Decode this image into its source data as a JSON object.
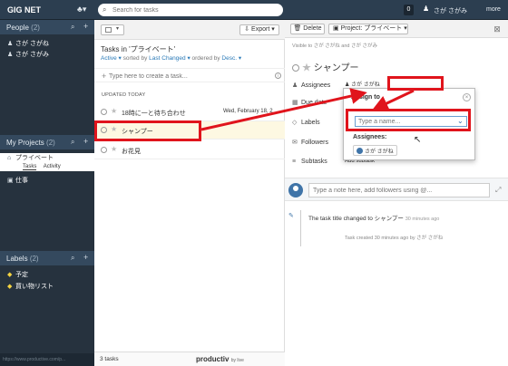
{
  "topbar": {
    "brand": "GIG NET",
    "search_placeholder": "Search for tasks",
    "notifications": "0",
    "user_name": "さが さがみ",
    "more": "more"
  },
  "sidebar": {
    "people": {
      "title": "People",
      "count": "(2)",
      "items": [
        {
          "label": "さが さがね"
        },
        {
          "label": "さが さがみ"
        }
      ]
    },
    "projects": {
      "title": "My Projects",
      "count": "(2)",
      "items": [
        {
          "label": "プライベート",
          "tabs": [
            "Tasks",
            "Activity"
          ]
        },
        {
          "label": "仕事"
        }
      ]
    },
    "labels": {
      "title": "Labels",
      "count": "(2)",
      "items": [
        {
          "label": "予定"
        },
        {
          "label": "買い物リスト"
        }
      ]
    },
    "status": "https://www.productive.com/p..."
  },
  "task_list": {
    "export_label": "Export",
    "title": "Tasks in 'プライベート'",
    "filter": {
      "state": "Active",
      "sorted_by_text": "sorted by",
      "sort": "Last Changed",
      "ordered_by_text": "ordered by",
      "order": "Desc."
    },
    "new_task_placeholder": "Type here to create a task...",
    "group_header": "UPDATED TODAY",
    "tasks": [
      {
        "name": "18時に一と待ち合わせ",
        "date": "Wed, February 18, 2"
      },
      {
        "name": "シャンプー",
        "date": ""
      },
      {
        "name": "お花見",
        "date": ""
      }
    ],
    "footer_count": "3 tasks",
    "footer_brand": "productiv",
    "footer_by": "by live"
  },
  "detail": {
    "delete_label": "Delete",
    "project_label": "Project: プライベート",
    "visible_to": "Visible to さが さがね and さが さがみ",
    "task_title": "シャンプー",
    "fields": {
      "assignees": "Assignees",
      "due": "Due date",
      "labels": "Labels",
      "followers": "Followers",
      "subtasks": "Subtasks",
      "add_subtask": "Add subtask"
    },
    "assignee_name": "さが さがね",
    "comment_placeholder": "Type a note here, add followers using @...",
    "activity": [
      {
        "text": "The task title changed to シャンプー",
        "time": "30 minutes ago"
      },
      {
        "text": "Task created 30 minutes ago by さが さがね"
      }
    ]
  },
  "popup": {
    "title": "Assign to",
    "placeholder": "Type a name...",
    "assignees_label": "Assignees:",
    "chip": "さが さがね"
  },
  "colors": {
    "topbar": "#2c3e50",
    "sidebar": "#26323e",
    "annotation": "#e0141c",
    "accent": "#2a7ab8"
  }
}
